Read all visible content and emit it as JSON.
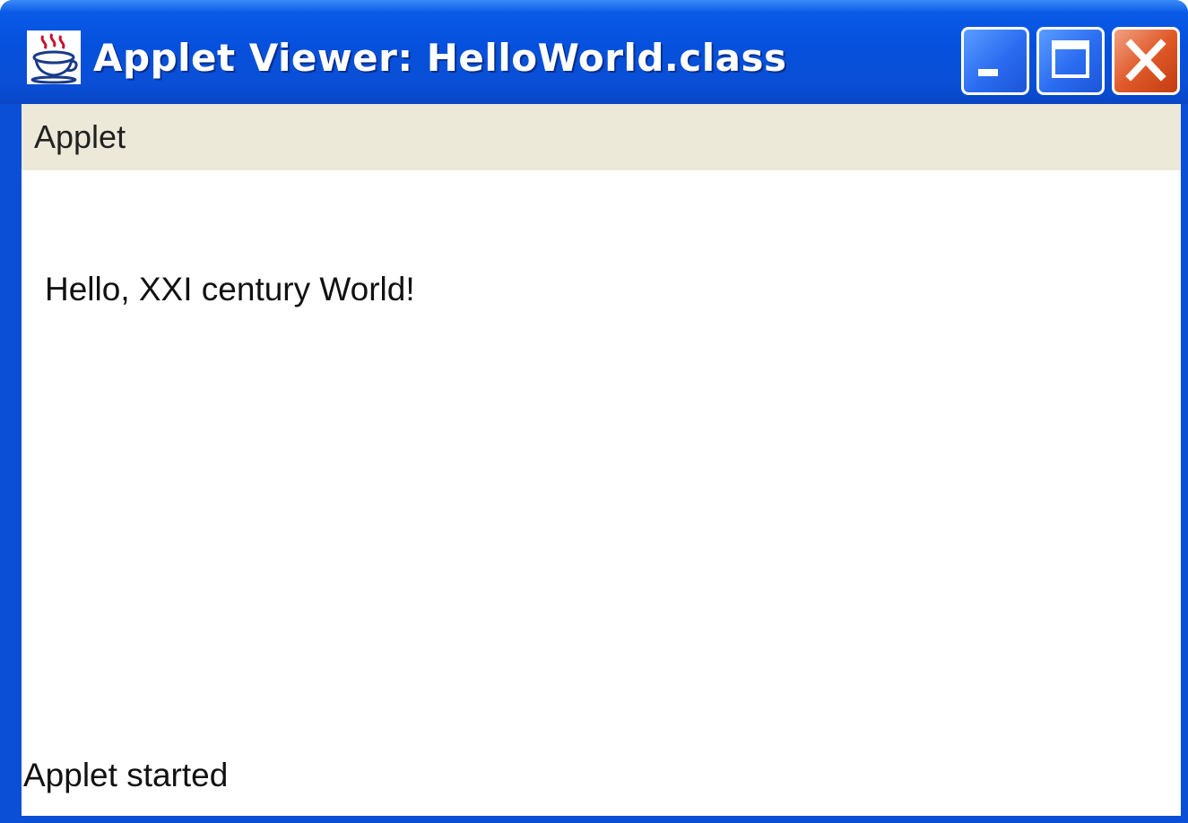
{
  "window": {
    "title": "Applet Viewer: HelloWorld.class",
    "app_icon": "java-cup-icon",
    "controls": {
      "minimize_icon": "minimize-icon",
      "maximize_icon": "maximize-icon",
      "close_icon": "close-icon"
    }
  },
  "menubar": {
    "items": [
      {
        "label": "Applet"
      }
    ]
  },
  "applet": {
    "message": "Hello, XXI century World!"
  },
  "status": {
    "text": "Applet started"
  },
  "colors": {
    "titlebar": "#0a4fd6",
    "close_button": "#e05a2a",
    "menubar": "#ece9d8",
    "content": "#ffffff"
  }
}
